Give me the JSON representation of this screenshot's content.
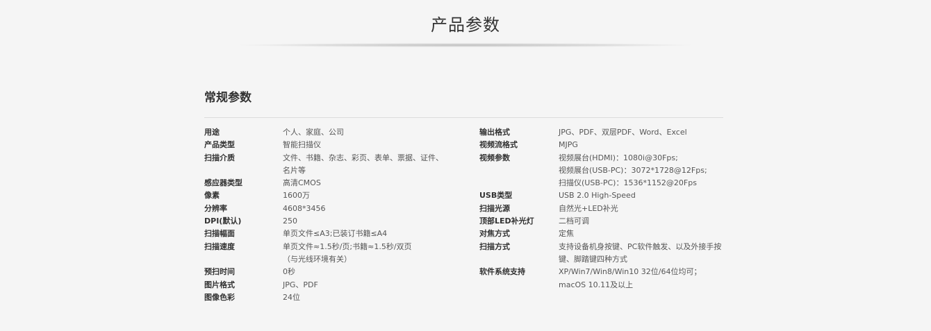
{
  "page_title": "产品参数",
  "section_title": "常规参数",
  "left_specs": [
    {
      "label": "用途",
      "lines": [
        "个人、家庭、公司"
      ]
    },
    {
      "label": "产品类型",
      "lines": [
        "智能扫描仪"
      ]
    },
    {
      "label": "扫描介质",
      "lines": [
        "文件、书籍、杂志、彩页、表单、票据、证件、",
        "名片等"
      ]
    },
    {
      "label": "感应器类型",
      "lines": [
        "高清CMOS"
      ]
    },
    {
      "label": "像素",
      "lines": [
        "1600万"
      ]
    },
    {
      "label": "分辨率",
      "lines": [
        "4608*3456"
      ]
    },
    {
      "label": "DPI(默认)",
      "lines": [
        "250"
      ]
    },
    {
      "label": "扫描幅面",
      "lines": [
        "单页文件≤A3;已装订书籍≤A4"
      ]
    },
    {
      "label": "扫描速度",
      "lines": [
        "单页文件≈1.5秒/页;书籍≈1.5秒/双页",
        "（与光线环境有关）"
      ]
    },
    {
      "label": "预扫时间",
      "lines": [
        "0秒"
      ]
    },
    {
      "label": "图片格式",
      "lines": [
        "JPG、PDF"
      ]
    },
    {
      "label": "图像色彩",
      "lines": [
        "24位"
      ]
    }
  ],
  "right_specs": [
    {
      "label": "输出格式",
      "lines": [
        "JPG、PDF、双层PDF、Word、Excel"
      ]
    },
    {
      "label": "视频流格式",
      "lines": [
        "MJPG"
      ]
    },
    {
      "label": "视频参数",
      "lines": [
        "视频展台(HDMI)：1080i@30Fps;",
        "视频展台(USB-PC)：3072*1728@12Fps;",
        "扫描仪(USB-PC)：1536*1152@20Fps"
      ]
    },
    {
      "label": "USB类型",
      "lines": [
        "USB 2.0 High-Speed"
      ]
    },
    {
      "label": "扫描光源",
      "lines": [
        "自然光+LED补光"
      ]
    },
    {
      "label": "顶部LED补光灯",
      "lines": [
        "二档可调"
      ]
    },
    {
      "label": "对焦方式",
      "lines": [
        "定焦"
      ]
    },
    {
      "label": "扫描方式",
      "lines": [
        "支持设备机身按键、PC软件触发、以及外接手按",
        "键、脚踏键四种方式"
      ]
    },
    {
      "label": "软件系统支持",
      "lines": [
        "XP/Win7/Win8/Win10 32位/64位均可；",
        "macOS 10.11及以上"
      ]
    }
  ]
}
